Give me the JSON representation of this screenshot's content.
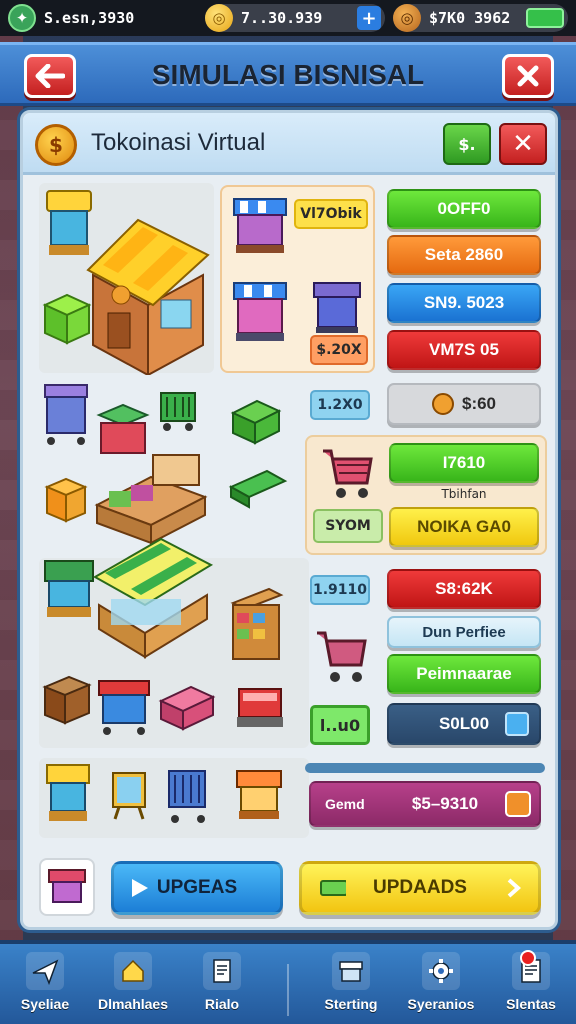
{
  "statusbar": {
    "stat1_value": "S.esn,3930",
    "stat2_value": "7..30.939",
    "stat2_plus": "+",
    "stat3_value": "$7K0 3962"
  },
  "header": {
    "title": "SIMULASI BISNISAL",
    "back_icon": "arrow-left-icon",
    "close_icon": "close-icon"
  },
  "panel": {
    "title": "Tokoinasi Virtual",
    "coin_symbol": "$",
    "green_button": "$.",
    "close_symbol": "✕",
    "tags": {
      "top_yellow": "Vl7Obik",
      "top_orange": "$.20X",
      "blue_small_1": "1.2X0",
      "cart_side": "SYOM",
      "blue_small_2": "1.9110",
      "green_small": "l..u0"
    },
    "buttons": {
      "btn_green": "0OFF0",
      "btn_orange": "Seta 2860",
      "btn_blue": "SN9. 5023",
      "btn_red": "VM7S 05",
      "price_grey": "$:60",
      "cart_green": "I7610",
      "cart_caption": "Tbihfan",
      "cart_yellow": "NOIKA GA0",
      "red_2": "S8:62K",
      "lightblue": "Dun Perfiee",
      "green_2": "Peimnaarae",
      "navy": "S0L00",
      "pink_label": "Gemd",
      "pink_value": "$5–9310"
    },
    "bottom": {
      "upgrade_blue": "UPGEAS",
      "upgrade_yellow": "UPDAADS"
    }
  },
  "nav": {
    "items": [
      {
        "label": "Syeliae",
        "icon": "plane-icon"
      },
      {
        "label": "Dlmahlaes",
        "icon": "home-icon"
      },
      {
        "label": "Rialo",
        "icon": "receipt-icon"
      },
      {
        "label": "Sterting",
        "icon": "store-icon"
      },
      {
        "label": "Syeranios",
        "icon": "gear-icon"
      },
      {
        "label": "Slentas",
        "icon": "document-icon"
      }
    ]
  },
  "colors": {
    "header_blue": "#2d6abb",
    "accent_green": "#38b51a",
    "accent_red": "#c01515",
    "accent_yellow": "#f0c80f",
    "nav_blue": "#23589a"
  }
}
